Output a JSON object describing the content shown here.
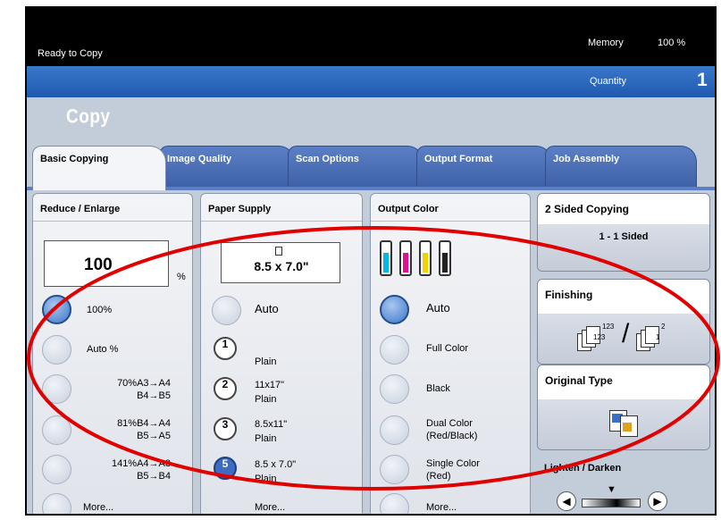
{
  "status": {
    "message": "Ready to Copy",
    "memory_label": "Memory",
    "memory_value": "100 %"
  },
  "quantity": {
    "label": "Quantity",
    "value": "1"
  },
  "app_title": "Copy",
  "tabs": [
    {
      "label": "Basic Copying",
      "active": true
    },
    {
      "label": "Image Quality",
      "active": false
    },
    {
      "label": "Scan Options",
      "active": false
    },
    {
      "label": "Output Format",
      "active": false
    },
    {
      "label": "Job Assembly",
      "active": false
    }
  ],
  "reduce_enlarge": {
    "title": "Reduce / Enlarge",
    "value": "100",
    "unit": "%",
    "options": [
      {
        "line1": "100%",
        "line2": "",
        "selected": true
      },
      {
        "line1": "Auto %",
        "line2": "",
        "selected": false
      },
      {
        "line1": "70%A3→A4",
        "line2": "B4→B5",
        "selected": false
      },
      {
        "line1": "81%B4→A4",
        "line2": "B5→A5",
        "selected": false
      },
      {
        "line1": "141%A4→A3",
        "line2": "B5→B4",
        "selected": false
      },
      {
        "line1": "More...",
        "line2": "",
        "selected": false
      }
    ]
  },
  "paper_supply": {
    "title": "Paper Supply",
    "value": "8.5 x 7.0\"",
    "auto_label": "Auto",
    "trays": [
      {
        "number": "1",
        "size": "",
        "type": "Plain",
        "selected": false
      },
      {
        "number": "2",
        "size": "11x17\"",
        "type": "Plain",
        "selected": false
      },
      {
        "number": "3",
        "size": "8.5x11\"",
        "type": "Plain",
        "selected": false
      },
      {
        "number": "5",
        "size": "8.5 x 7.0\"",
        "type": "Plain",
        "selected": true
      }
    ],
    "more_label": "More..."
  },
  "output_color": {
    "title": "Output Color",
    "options": [
      {
        "line1": "Auto",
        "line2": "",
        "selected": true
      },
      {
        "line1": "Full Color",
        "line2": "",
        "selected": false
      },
      {
        "line1": "Black",
        "line2": "",
        "selected": false
      },
      {
        "line1": "Dual Color",
        "line2": "(Red/Black)",
        "selected": false
      },
      {
        "line1": "Single Color",
        "line2": "(Red)",
        "selected": false
      },
      {
        "line1": "More...",
        "line2": "",
        "selected": false
      }
    ],
    "toner_colors": [
      "#00b8e6",
      "#e0118c",
      "#f2d200",
      "#222222"
    ]
  },
  "two_sided": {
    "title": "2 Sided Copying",
    "value": "1 - 1 Sided"
  },
  "finishing": {
    "title": "Finishing",
    "stack_labels": [
      "123",
      "123",
      "2",
      "1"
    ]
  },
  "original_type": {
    "title": "Original Type"
  },
  "lighten_darken": {
    "title": "Lighten / Darken",
    "level": 0.5
  },
  "colors": {
    "brand_blue": "#1e59b0",
    "annotation_red": "#e00000"
  }
}
